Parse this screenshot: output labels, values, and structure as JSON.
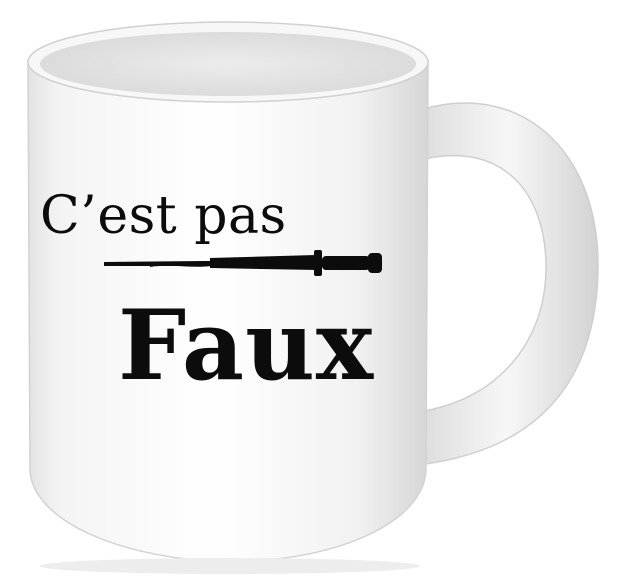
{
  "product": {
    "line1": "C’est pas",
    "line2": "Faux"
  },
  "colors": {
    "mug_white": "#f5f5f5",
    "mug_shadow": "#d9d9d9",
    "ink": "#0c0c0c",
    "background": "#ffffff"
  },
  "decoration": {
    "icon": "sword-icon"
  }
}
